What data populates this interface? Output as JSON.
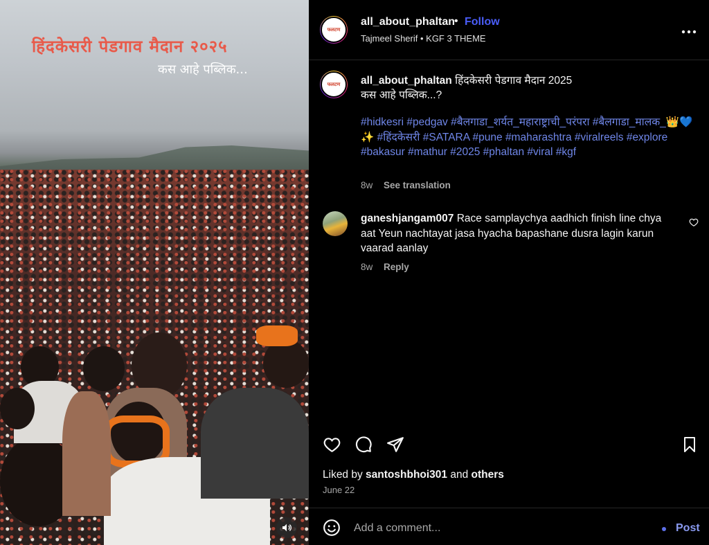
{
  "media": {
    "title_text": "हिंदकेसरी पेडगाव मैदान २०२५",
    "subtitle_text": "कस आहे पब्लिक..."
  },
  "header": {
    "username": "all_about_phaltan",
    "separator": "•",
    "follow_label": "Follow",
    "audio_line": "Tajmeel Sherif • KGF 3 THEME",
    "avatar_text": "फलटण"
  },
  "caption": {
    "username": "all_about_phaltan",
    "line1": "हिंदकेसरी पेडगाव मैदान 2025",
    "line2": "कस आहे पब्लिक...?",
    "hashtags": "#hidkesri #pedgav #बैलगाडा_शर्यत_महाराष्ट्राची_परंपरा #बैलगाडा_मालक_👑💙✨ #हिंदकेसरी #SATARA #pune #maharashtra #viralreels #explore #bakasur #mathur #2025 #phaltan #viral #kgf",
    "age": "8w",
    "see_translation": "See translation"
  },
  "comment": {
    "username": "ganeshjangam007",
    "text": "Race samplaychya aadhich finish line chya aat Yeun nachtayat jasa hyacha bapashane dusra lagin karun vaarad aanlay",
    "age": "8w",
    "reply_label": "Reply"
  },
  "likes": {
    "prefix": "Liked by",
    "user": "santoshbhoi301",
    "middle": "and",
    "others": "others"
  },
  "date": "June 22",
  "composer": {
    "placeholder": "Add a comment...",
    "post_label": "Post"
  },
  "icons": [
    "heart-icon",
    "comment-icon",
    "share-icon",
    "bookmark-icon",
    "emoji-icon",
    "more-icon",
    "audio-icon"
  ]
}
